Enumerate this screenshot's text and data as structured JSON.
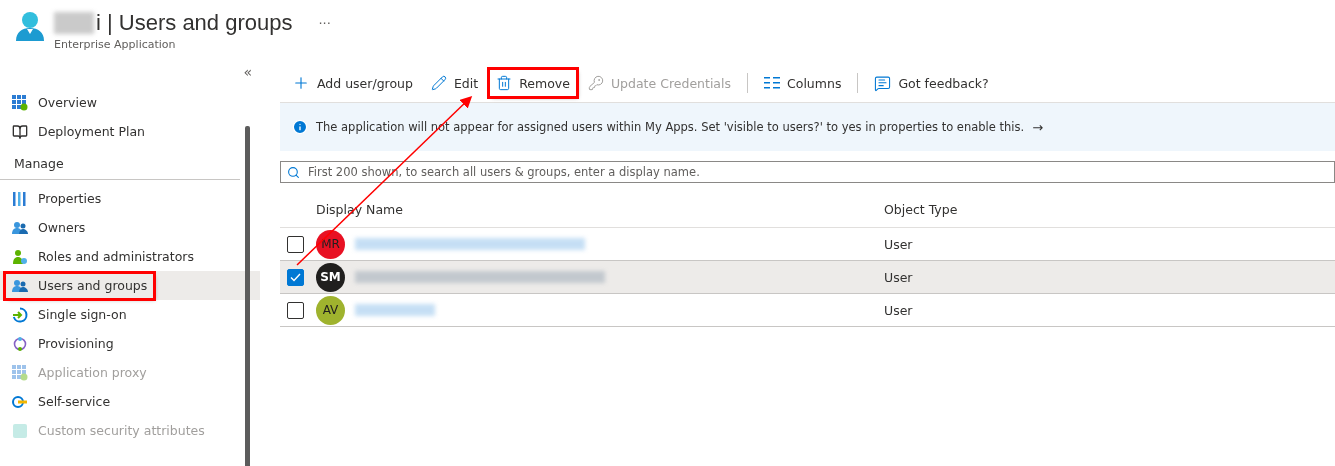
{
  "header": {
    "title": "i | Users and groups",
    "subtitle": "Enterprise Application",
    "more": "···"
  },
  "sidebar": {
    "collapse": "«",
    "items": [
      {
        "kind": "link",
        "label": "Overview",
        "selected": false,
        "disabled": false,
        "highlighted": false
      },
      {
        "kind": "link",
        "label": "Deployment Plan",
        "selected": false,
        "disabled": false,
        "highlighted": false
      },
      {
        "kind": "heading",
        "label": "Manage"
      },
      {
        "kind": "link",
        "label": "Properties",
        "selected": false,
        "disabled": false,
        "highlighted": false
      },
      {
        "kind": "link",
        "label": "Owners",
        "selected": false,
        "disabled": false,
        "highlighted": false
      },
      {
        "kind": "link",
        "label": "Roles and administrators",
        "selected": false,
        "disabled": false,
        "highlighted": false
      },
      {
        "kind": "link",
        "label": "Users and groups",
        "selected": true,
        "disabled": false,
        "highlighted": true
      },
      {
        "kind": "link",
        "label": "Single sign-on",
        "selected": false,
        "disabled": false,
        "highlighted": false
      },
      {
        "kind": "link",
        "label": "Provisioning",
        "selected": false,
        "disabled": false,
        "highlighted": false
      },
      {
        "kind": "link",
        "label": "Application proxy",
        "selected": false,
        "disabled": true,
        "highlighted": false
      },
      {
        "kind": "link",
        "label": "Self-service",
        "selected": false,
        "disabled": false,
        "highlighted": false
      },
      {
        "kind": "link",
        "label": "Custom security attributes",
        "selected": false,
        "disabled": true,
        "highlighted": false
      }
    ]
  },
  "toolbar": [
    {
      "kind": "button",
      "label": "Add user/group",
      "disabled": false,
      "highlighted": false
    },
    {
      "kind": "button",
      "label": "Edit",
      "disabled": false,
      "highlighted": false
    },
    {
      "kind": "button",
      "label": "Remove",
      "disabled": false,
      "highlighted": true
    },
    {
      "kind": "button",
      "label": "Update Credentials",
      "disabled": true,
      "highlighted": false
    },
    {
      "kind": "separator"
    },
    {
      "kind": "button",
      "label": "Columns",
      "disabled": false,
      "highlighted": false
    },
    {
      "kind": "separator"
    },
    {
      "kind": "button",
      "label": "Got feedback?",
      "disabled": false,
      "highlighted": false
    }
  ],
  "info_bar": {
    "text": "The application will not appear for assigned users within My Apps. Set 'visible to users?' to yes in properties to enable this.",
    "arrow": "→"
  },
  "search": {
    "placeholder": "First 200 shown, to search all users & groups, enter a display name."
  },
  "table": {
    "columns": [
      "Display Name",
      "Object Type"
    ],
    "rows": [
      {
        "initials": "MR",
        "color": "#e81123",
        "checked": false,
        "selected": false,
        "object_type": "User"
      },
      {
        "initials": "SM",
        "color": "#201f1e",
        "checked": true,
        "selected": true,
        "object_type": "User"
      },
      {
        "initials": "AV",
        "color": "#9fb32e",
        "checked": false,
        "selected": false,
        "object_type": "User"
      }
    ]
  },
  "annotation": {
    "arrow": true
  }
}
